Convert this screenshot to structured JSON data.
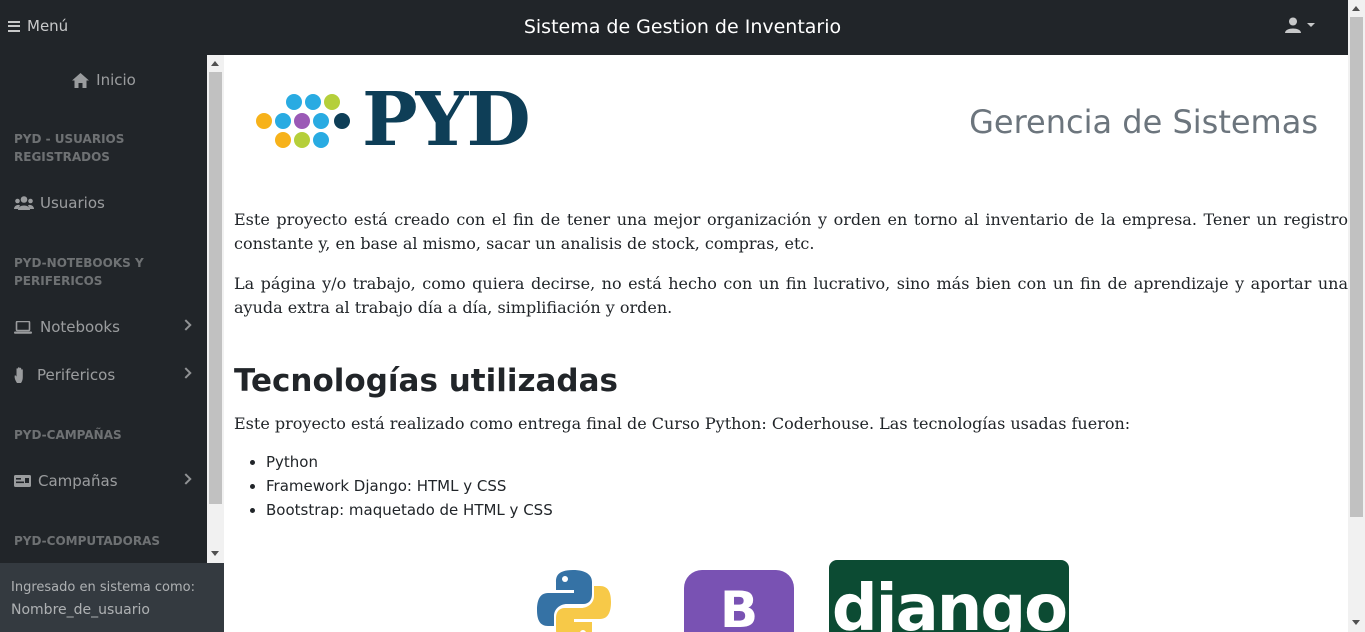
{
  "topbar": {
    "menu_label": "Menú",
    "title": "Sistema de Gestion de Inventario"
  },
  "sidebar": {
    "home": "Inicio",
    "sections": [
      {
        "heading": "PYD - USUARIOS REGISTRADOS",
        "items": [
          "Usuarios"
        ]
      },
      {
        "heading": "PYD-NOTEBOOKS Y PERIFERICOS",
        "items": [
          "Notebooks",
          "Perifericos"
        ]
      },
      {
        "heading": "PYD-CAMPAÑAS",
        "items": [
          "Campañas"
        ]
      },
      {
        "heading": "PYD-COMPUTADORAS",
        "items": []
      }
    ],
    "footer_label": "Ingresado en sistema como:",
    "footer_user": "Nombre_de_usuario"
  },
  "main": {
    "logo_text": "PYD",
    "department": "Gerencia de Sistemas",
    "paragraphs": [
      "Este proyecto está creado con el fin de tener una mejor organización y orden en torno al inventario de la empresa. Tener un registro constante y, en base al mismo, sacar un analisis de stock, compras, etc.",
      "La página y/o trabajo, como quiera decirse, no está hecho con un fin lucrativo, sino más bien con un fin de aprendizaje y aportar una ayuda extra al trabajo día a día, simplifiación y orden."
    ],
    "tech_heading": "Tecnologías utilizadas",
    "tech_intro": "Este proyecto está realizado como entrega final de Curso Python: Coderhouse. Las tecnologías usadas fueron:",
    "tech_list": [
      "Python",
      "Framework Django: HTML y CSS",
      "Bootstrap: maquetado de HTML y CSS"
    ],
    "logos": {
      "bootstrap": "B",
      "django": "django"
    }
  },
  "colors": {
    "navbar": "#212529",
    "brand_dark": "#0e3e57",
    "django_green": "#0c4b33",
    "bootstrap_purple": "#7952b3"
  }
}
